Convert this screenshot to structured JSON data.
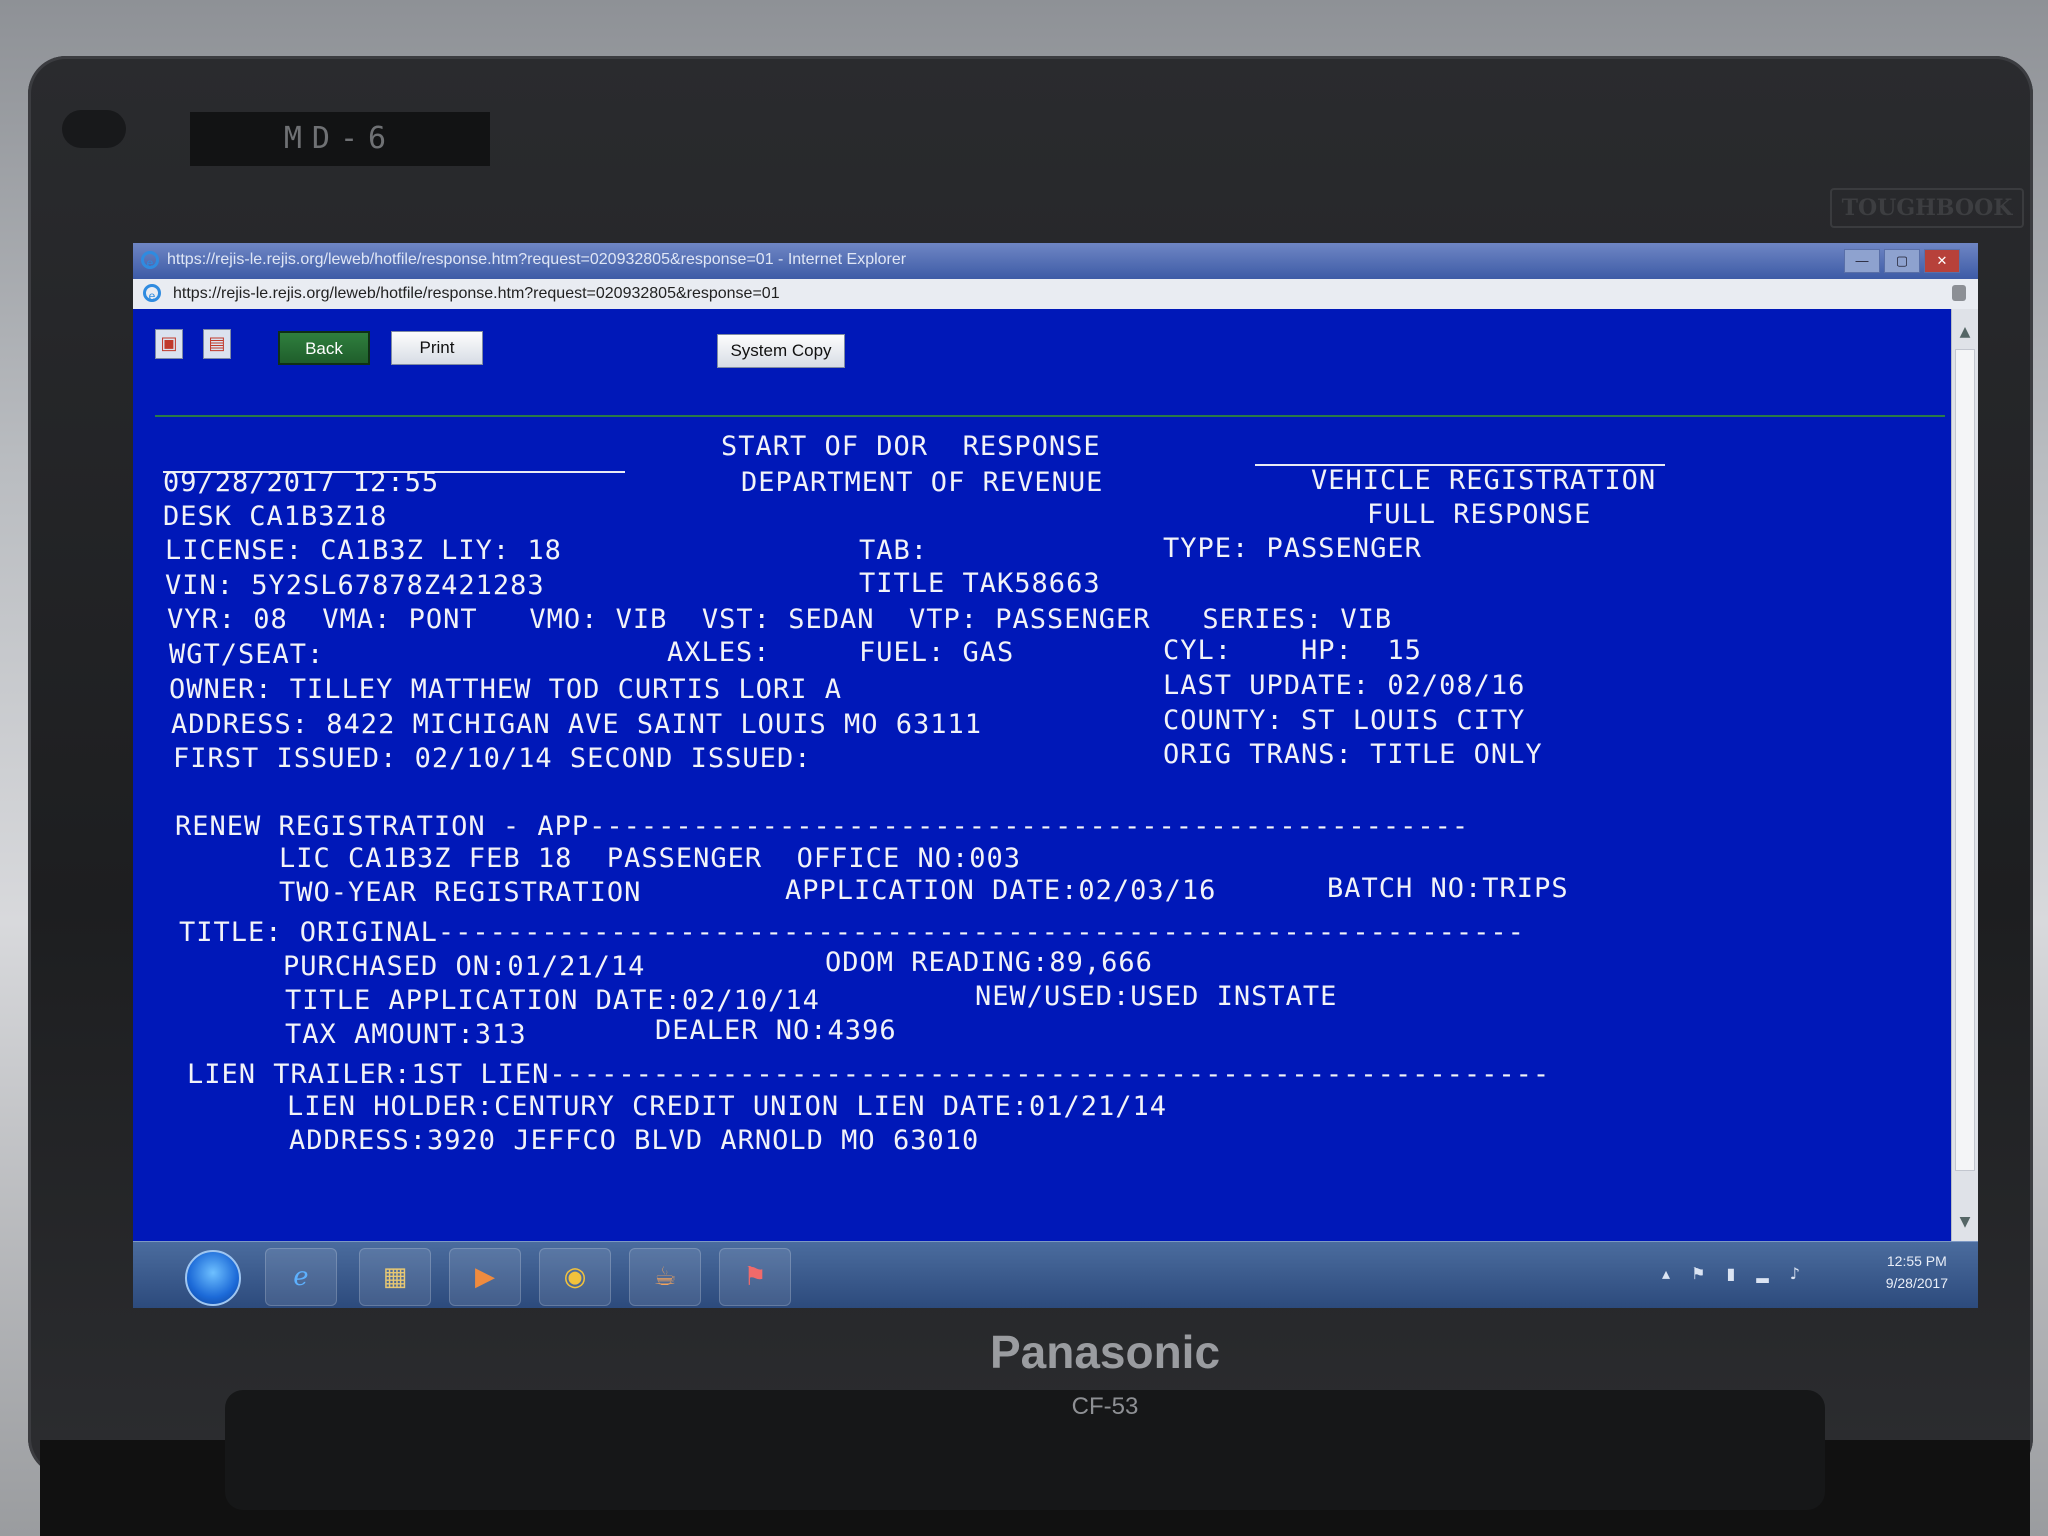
{
  "hardware": {
    "asset_label": "MD-6",
    "series_badge": "TOUGHBOOK",
    "brand": "Panasonic",
    "model": "CF-53"
  },
  "browser": {
    "window_title": "https://rejis-le.rejis.org/leweb/hotfile/response.htm?request=020932805&response=01 - Internet Explorer",
    "address": "https://rejis-le.rejis.org/leweb/hotfile/response.htm?request=020932805&response=01",
    "window_buttons": [
      "minimize",
      "maximize",
      "close"
    ],
    "window_button_glyphs": [
      "—",
      "▢",
      "✕"
    ]
  },
  "toolbar": {
    "back_label": "Back",
    "print_label": "Print",
    "system_copy_label": "System Copy"
  },
  "report": {
    "start_banner": "START OF DOR  RESPONSE",
    "datetime": "09/28/2017 12:55",
    "department": "DEPARTMENT OF REVENUE",
    "record_type": "VEHICLE REGISTRATION",
    "full_response": "FULL RESPONSE",
    "desk": "DESK CA1B3Z18",
    "license_line": "LICENSE: CA1B3Z LIY: 18",
    "tab": "TAB:",
    "type": "TYPE: PASSENGER",
    "vin": "VIN: 5Y2SL67878Z421283",
    "title": "TITLE TAK58663",
    "vehicle_line": "VYR: 08  VMA: PONT   VMO: VIB  VST: SEDAN  VTP: PASSENGER   SERIES: VIB",
    "wgt_seat": "WGT/SEAT:",
    "axles": "AXLES:",
    "fuel": "FUEL: GAS",
    "cyl_hp": "CYL:    HP:  15",
    "owner": "OWNER: TILLEY MATTHEW TOD CURTIS LORI A",
    "last_update": "LAST UPDATE: 02/08/16",
    "address": "ADDRESS: 8422 MICHIGAN AVE SAINT LOUIS MO 63111",
    "county": "COUNTY: ST LOUIS CITY",
    "first_issued": "FIRST ISSUED: 02/10/14 SECOND ISSUED:",
    "orig_trans": "ORIG TRANS: TITLE ONLY",
    "renew_header": "RENEW REGISTRATION - APP---------------------------------------------------",
    "renew_lic": "LIC CA1B3Z FEB 18  PASSENGER  OFFICE NO:003",
    "renew_term": "TWO-YEAR REGISTRATION",
    "renew_app_date": "APPLICATION DATE:02/03/16",
    "renew_batch": "BATCH NO:TRIPS",
    "title_header": "TITLE: ORIGINAL---------------------------------------------------------------",
    "purchased_on": "PURCHASED ON:01/21/14",
    "odom": "ODOM READING:89,666",
    "title_app_date": "TITLE APPLICATION DATE:02/10/14",
    "new_used": "NEW/USED:USED INSTATE",
    "tax_amount": "TAX AMOUNT:313",
    "dealer_no": "DEALER NO:4396",
    "lien_header": "LIEN TRAILER:1ST LIEN----------------------------------------------------------",
    "lien_holder": "LIEN HOLDER:CENTURY CREDIT UNION LIEN DATE:01/21/14",
    "lien_address": "ADDRESS:3920 JEFFCO BLVD ARNOLD MO 63010"
  },
  "taskbar": {
    "pinned_icons": [
      "start-orb-icon",
      "internet-explorer-icon",
      "folder-icon",
      "media-player-icon",
      "chrome-icon",
      "java-icon",
      "flag-icon"
    ],
    "tray_icons": [
      "chevron-up-icon",
      "flag-icon",
      "battery-icon",
      "signal-icon",
      "volume-icon"
    ],
    "tray_glyphs": "▴ ⚑ ▮ ▂ ♪",
    "time": "12:55 PM",
    "date": "9/28/2017"
  }
}
